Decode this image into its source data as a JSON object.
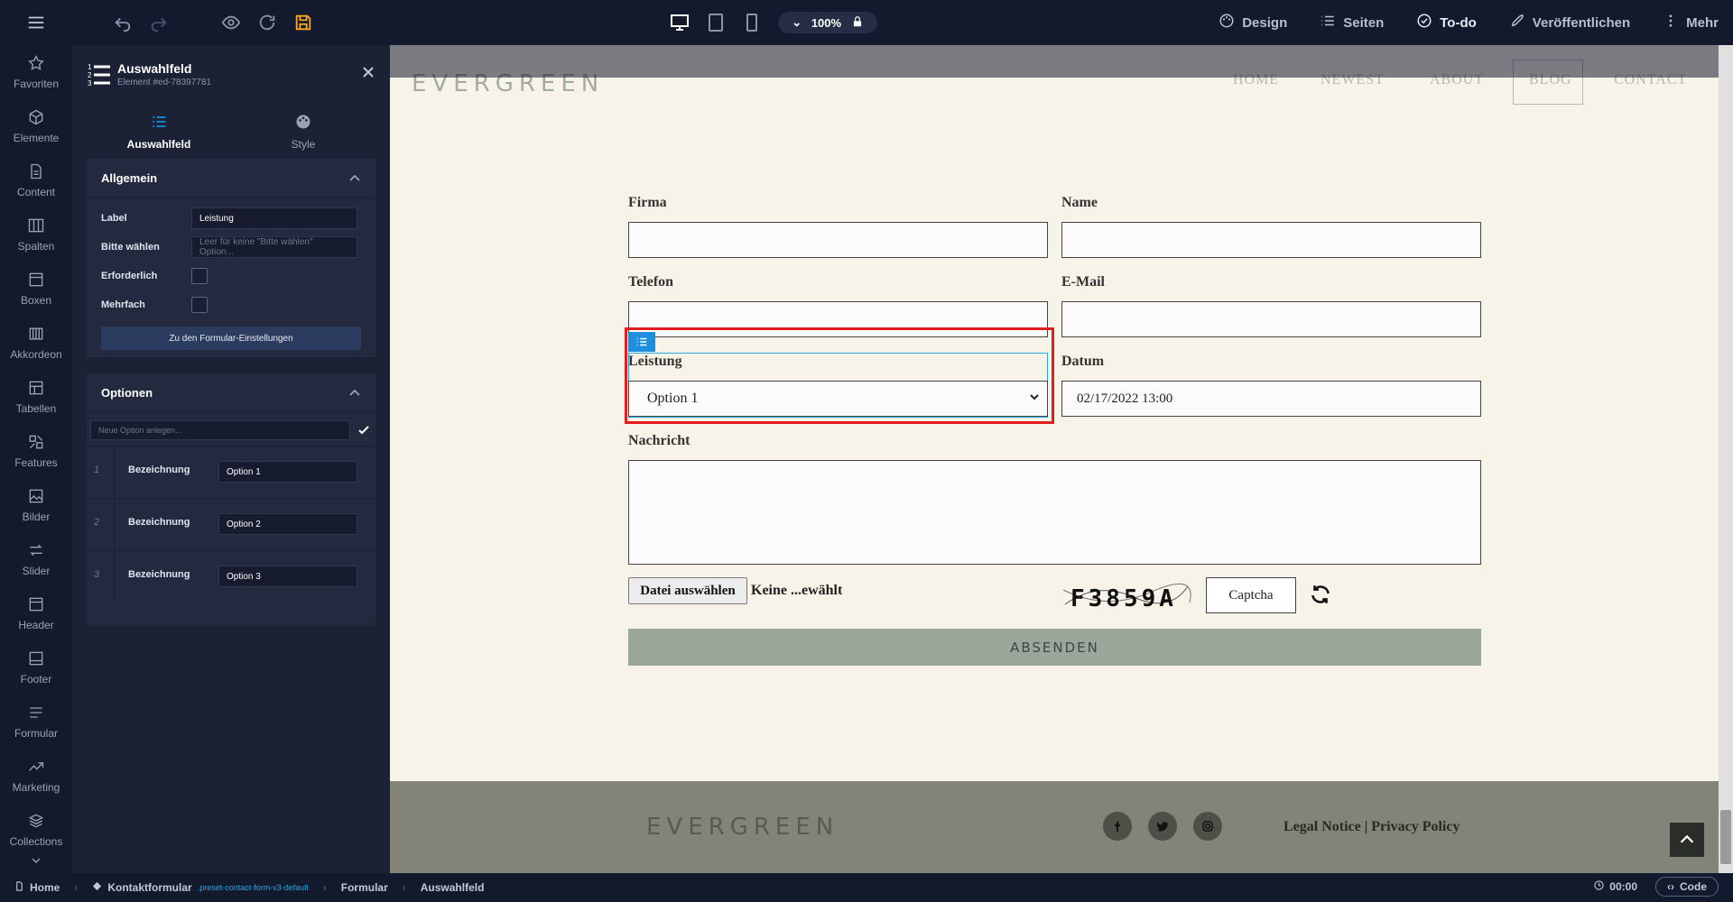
{
  "topbar": {
    "zoom": "100%",
    "design": "Design",
    "seiten": "Seiten",
    "todo": "To-do",
    "publish": "Veröffentlichen",
    "mehr": "Mehr",
    "accent_save": "#f5a623"
  },
  "rail": {
    "items": [
      {
        "label": "Favoriten",
        "icon": "star-icon"
      },
      {
        "label": "Elemente",
        "icon": "cube-icon"
      },
      {
        "label": "Content",
        "icon": "document-icon"
      },
      {
        "label": "Spalten",
        "icon": "columns-icon"
      },
      {
        "label": "Boxen",
        "icon": "box-icon"
      },
      {
        "label": "Akkordeon",
        "icon": "accordion-icon"
      },
      {
        "label": "Tabellen",
        "icon": "table-icon"
      },
      {
        "label": "Features",
        "icon": "features-icon"
      },
      {
        "label": "Bilder",
        "icon": "image-icon"
      },
      {
        "label": "Slider",
        "icon": "slider-icon"
      },
      {
        "label": "Header",
        "icon": "header-icon"
      },
      {
        "label": "Footer",
        "icon": "footer-icon"
      },
      {
        "label": "Formular",
        "icon": "form-icon"
      },
      {
        "label": "Marketing",
        "icon": "trend-icon"
      },
      {
        "label": "Collections",
        "icon": "layers-icon"
      }
    ]
  },
  "panel": {
    "title": "Auswahlfeld",
    "subtitle": "Element #ed-78397781",
    "tab_main": "Auswahlfeld",
    "tab_style": "Style",
    "general": {
      "heading": "Allgemein",
      "label_label": "Label",
      "label_value": "Leistung",
      "choose_label": "Bitte wählen",
      "choose_placeholder": "Leer für keine \"Bitte wählen\" Option...",
      "required_label": "Erforderlich",
      "multiple_label": "Mehrfach",
      "form_settings_button": "Zu den Formular-Einstellungen"
    },
    "options": {
      "heading": "Optionen",
      "new_placeholder": "Neue Option anlegen...",
      "rows": [
        {
          "num": "1",
          "label": "Bezeichnung",
          "value": "Option 1"
        },
        {
          "num": "2",
          "label": "Bezeichnung",
          "value": "Option 2"
        },
        {
          "num": "3",
          "label": "Bezeichnung",
          "value": "Option 3"
        }
      ]
    }
  },
  "site": {
    "logo": "EVERGREEN",
    "nav": [
      "HOME",
      "NEWEST",
      "ABOUT",
      "BLOG",
      "CONTACT"
    ],
    "form": {
      "firma": "Firma",
      "name": "Name",
      "telefon": "Telefon",
      "email": "E-Mail",
      "leistung": "Leistung",
      "leistung_value": "Option 1",
      "datum": "Datum",
      "datum_value": "02/17/2022 13:00",
      "nachricht": "Nachricht",
      "file_button": "Datei auswählen",
      "file_text": "Keine ...ewählt",
      "captcha_text": "F3859A",
      "captcha_placeholder": "Captcha",
      "submit": "ABSENDEN"
    },
    "footer": {
      "logo": "EVERGREEN",
      "legal": "Legal Notice | Privacy Policy",
      "social": [
        "facebook-icon",
        "twitter-icon",
        "instagram-icon"
      ]
    }
  },
  "status": {
    "home": "Home",
    "page": "Kontaktformular",
    "page_tag": ".preset-contact-form-v3-default",
    "formular": "Formular",
    "element": "Auswahlfeld",
    "time": "00:00",
    "code": "Code"
  }
}
